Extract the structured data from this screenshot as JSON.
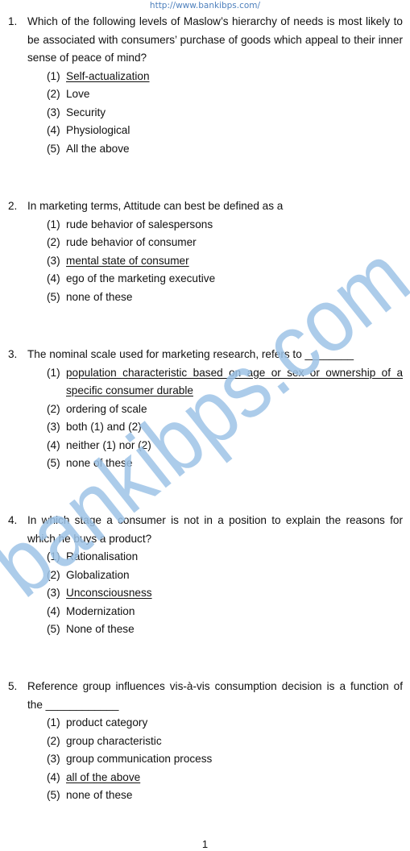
{
  "header": {
    "url": "http://www.bankibps.com/"
  },
  "watermark": {
    "text": "bankibps.com",
    "color": "#9dc3e6"
  },
  "questions": [
    {
      "number": "1.",
      "lines": [
        "Which of the following levels of Maslow’s hierarchy of needs is most likely to be associated with consumers’ purchase of goods which appeal to their inner sense of peace of mind?"
      ],
      "options": [
        {
          "number": "(1)",
          "text": "Self-actualization",
          "answer": true
        },
        {
          "number": "(2)",
          "text": "Love",
          "answer": false
        },
        {
          "number": "(3)",
          "text": "Security",
          "answer": false
        },
        {
          "number": "(4)",
          "text": "Physiological",
          "answer": false
        },
        {
          "number": "(5)",
          "text": "All the above",
          "answer": false
        }
      ]
    },
    {
      "number": "2.",
      "lines": [
        "In marketing terms, Attitude can best be defined as a"
      ],
      "options": [
        {
          "number": "(1)",
          "text": "rude behavior of salespersons",
          "answer": false
        },
        {
          "number": "(2)",
          "text": "rude behavior of consumer",
          "answer": false
        },
        {
          "number": "(3)",
          "text": "mental state of consumer",
          "answer": true
        },
        {
          "number": "(4)",
          "text": "ego of the marketing executive",
          "answer": false
        },
        {
          "number": "(5)",
          "text": "none of these",
          "answer": false
        }
      ]
    },
    {
      "number": "3.",
      "lines": [
        "The nominal scale used for marketing research, refers to ________"
      ],
      "options": [
        {
          "number": "(1)",
          "text_line1": "population characteristic based on age or sex or ownership of a",
          "text_line2": "specific consumer durable",
          "answer": true
        },
        {
          "number": "(2)",
          "text": "ordering of scale",
          "answer": false
        },
        {
          "number": "(3)",
          "text": "both (1) and (2)",
          "answer": false
        },
        {
          "number": "(4)",
          "text": "neither (1) nor (2)",
          "answer": false
        },
        {
          "number": "(5)",
          "text": "none of these",
          "answer": false
        }
      ]
    },
    {
      "number": "4.",
      "lines": [
        "In which stage a consumer is not in a position to explain the reasons for which he buys a product?"
      ],
      "options": [
        {
          "number": "(1)",
          "text": "Rationalisation",
          "answer": false
        },
        {
          "number": "(2)",
          "text": "Globalization",
          "answer": false
        },
        {
          "number": "(3)",
          "text": "Unconsciousness",
          "answer": true
        },
        {
          "number": "(4)",
          "text": "Modernization",
          "answer": false
        },
        {
          "number": "(5)",
          "text": "None of these",
          "answer": false
        }
      ]
    },
    {
      "number": "5.",
      "lines": [
        "Reference group influences vis-à-vis consumption decision is a function of the ____________"
      ],
      "options": [
        {
          "number": "(1)",
          "text": "product category",
          "answer": false
        },
        {
          "number": "(2)",
          "text": "group characteristic",
          "answer": false
        },
        {
          "number": "(3)",
          "text": "group communication process",
          "answer": false
        },
        {
          "number": "(4)",
          "text": "all of the above",
          "answer": true
        },
        {
          "number": "(5)",
          "text": "none of these",
          "answer": false
        }
      ]
    }
  ],
  "footer": {
    "page_number": "1"
  }
}
